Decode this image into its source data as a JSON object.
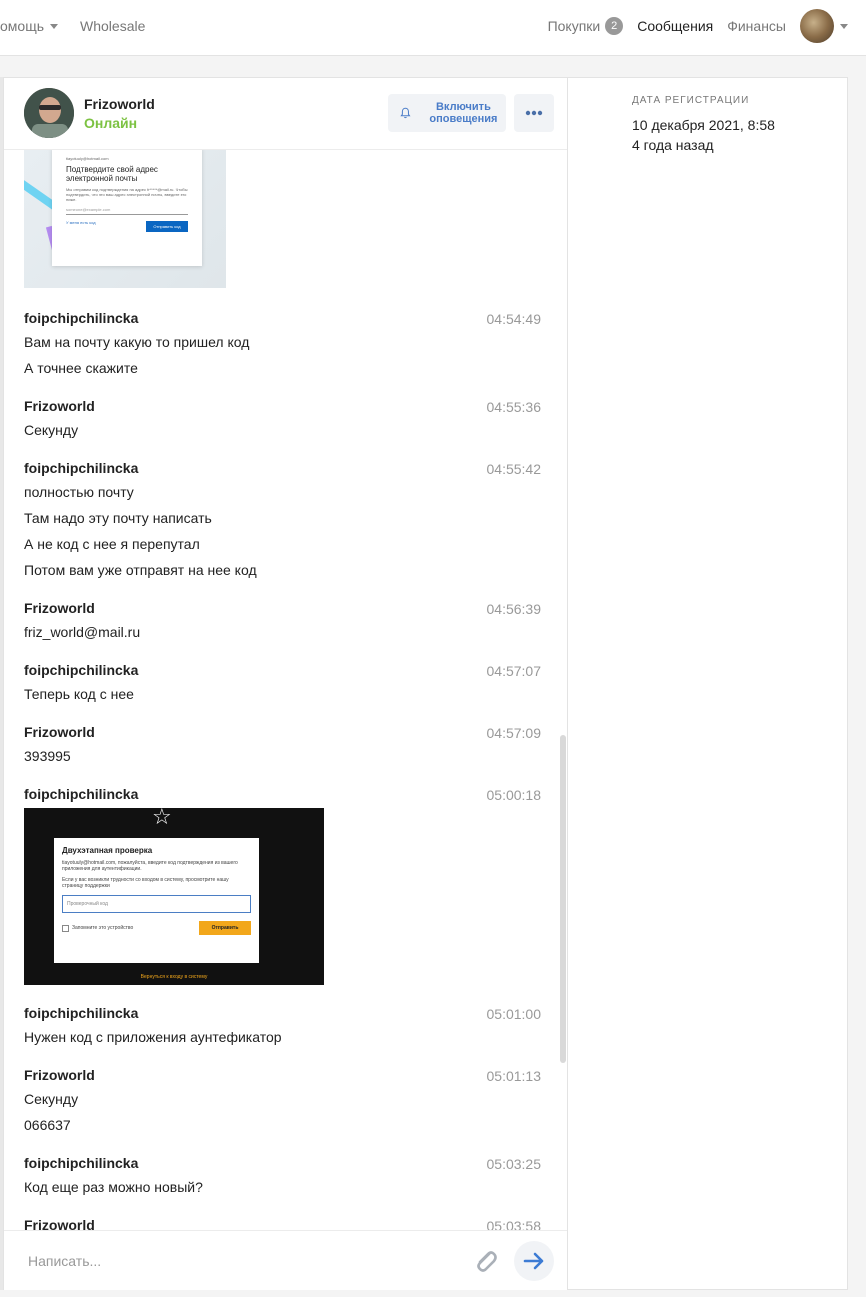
{
  "nav": {
    "help": "омощь",
    "wholesale": "Wholesale",
    "purchases": "Покупки",
    "purchases_count": "2",
    "messages": "Сообщения",
    "finance": "Финансы"
  },
  "chat": {
    "contact_name": "Frizoworld",
    "status": "Онлайн",
    "notify_label": "Включить оповещения",
    "input_placeholder": "Написать...",
    "image1": {
      "small_top": "tiayotuuly@hotmail.com",
      "title": "Подтвердите свой адрес электронной почты",
      "text": "Мы отправим код подтверждения на адрес fr*****@mail.ru. Чтобы подтвердить, что это ваш адрес электронной почты, введите его ниже.",
      "field": "someone@example.com",
      "link": "У меня есть код",
      "button": "Отправить код"
    },
    "image2": {
      "title": "Двухэтапная проверка",
      "text1": "tiayotuuly@hotmail.com, пожалуйста, введите код подтверждения из вашего приложения для аутентификации.",
      "text2": "Если у вас возникли трудности со входом в систему, просмотрите нашу страницу поддержки",
      "input": "Проверочный код",
      "remember": "Запомните это устройство",
      "button": "Отправить",
      "back": "Вернуться к входу в систему"
    },
    "messages": [
      {
        "author": "foipchipchilincka",
        "time": "04:54:49",
        "lines": [
          "Вам на почту какую то пришел код",
          "А точнее скажите"
        ]
      },
      {
        "author": "Frizoworld",
        "time": "04:55:36",
        "lines": [
          "Секунду"
        ]
      },
      {
        "author": "foipchipchilincka",
        "time": "04:55:42",
        "lines": [
          "полностью почту",
          "Там надо эту почту написать",
          "А не код с нее я перепутал",
          "Потом вам уже отправят на нее код"
        ]
      },
      {
        "author": "Frizoworld",
        "time": "04:56:39",
        "lines": [
          "friz_world@mail.ru"
        ]
      },
      {
        "author": "foipchipchilincka",
        "time": "04:57:07",
        "lines": [
          "Теперь код с нее"
        ]
      },
      {
        "author": "Frizoworld",
        "time": "04:57:09",
        "lines": [
          "393995"
        ]
      },
      {
        "author": "foipchipchilincka",
        "time": "05:00:18",
        "lines": []
      },
      {
        "author": "foipchipchilincka",
        "time": "05:01:00",
        "lines": [
          "Нужен код с приложения аунтефикатор"
        ]
      },
      {
        "author": "Frizoworld",
        "time": "05:01:13",
        "lines": [
          "Секунду",
          "066637"
        ]
      },
      {
        "author": "foipchipchilincka",
        "time": "05:03:25",
        "lines": [
          "Код еще раз можно новый?"
        ]
      },
      {
        "author": "Frizoworld",
        "time": "05:03:58",
        "lines": []
      }
    ]
  },
  "profile": {
    "reg_label": "ДАТА РЕГИСТРАЦИИ",
    "reg_date": "10 декабря 2021, 8:58",
    "reg_ago": "4 года назад"
  }
}
